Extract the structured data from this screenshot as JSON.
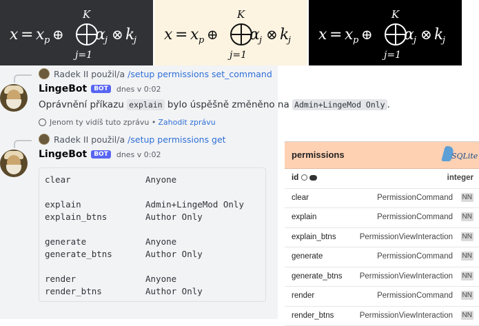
{
  "formula_tiles": [
    {
      "bg": "#303236",
      "ink": "#ffffff"
    },
    {
      "bg": "#fcf4e1",
      "ink": "#111111"
    },
    {
      "bg": "#000000",
      "ink": "#ffffff"
    }
  ],
  "formula": {
    "lhs": "x",
    "eq": "=",
    "xp": "x",
    "xp_sub": "p",
    "oplus": "⊕",
    "upper": "K",
    "lower": "j=1",
    "alpha": "α",
    "alpha_sub": "j",
    "otimes": "⊗",
    "k": "k",
    "k_sub": "j"
  },
  "chat": {
    "messages": [
      {
        "reply_user": "Radek II",
        "reply_action": "použil/a",
        "reply_command": "/setup permissions set_command",
        "author": "LingeBot",
        "bot_tag": "BOT",
        "timestamp": "dnes v 0:02",
        "text_before": "Oprávnění příkazu",
        "code1": "explain",
        "text_middle": "bylo úspěšně změněno na",
        "code2": "Admin+LingeMod Only",
        "text_after": ".",
        "ephemeral_note": "Jenom ty vidíš tuto zprávu •",
        "dismiss_link": "Zahodit zprávu"
      },
      {
        "reply_user": "Radek II",
        "reply_action": "použil/a",
        "reply_command": "/setup permissions get",
        "author": "LingeBot",
        "bot_tag": "BOT",
        "timestamp": "dnes v 0:02"
      }
    ],
    "permissions_block": [
      [
        {
          "k": "clear",
          "v": "Anyone"
        }
      ],
      [
        {
          "k": "explain",
          "v": "Admin+LingeMod Only"
        },
        {
          "k": "explain_btns",
          "v": "Author Only"
        }
      ],
      [
        {
          "k": "generate",
          "v": "Anyone"
        },
        {
          "k": "generate_btns",
          "v": "Author Only"
        }
      ],
      [
        {
          "k": "render",
          "v": "Anyone"
        },
        {
          "k": "render_btns",
          "v": "Author Only"
        }
      ]
    ]
  },
  "sqlite": {
    "table_name": "permissions",
    "logo_text": "SQLite",
    "id_row": {
      "name": "id",
      "type": "integer"
    },
    "nn_label": "NN",
    "rows": [
      {
        "name": "clear",
        "type": "PermissionCommand"
      },
      {
        "name": "explain",
        "type": "PermissionCommand"
      },
      {
        "name": "explain_btns",
        "type": "PermissionViewInteraction"
      },
      {
        "name": "generate",
        "type": "PermissionCommand"
      },
      {
        "name": "generate_btns",
        "type": "PermissionViewInteraction"
      },
      {
        "name": "render",
        "type": "PermissionCommand"
      },
      {
        "name": "render_btns",
        "type": "PermissionViewInteraction"
      }
    ]
  }
}
